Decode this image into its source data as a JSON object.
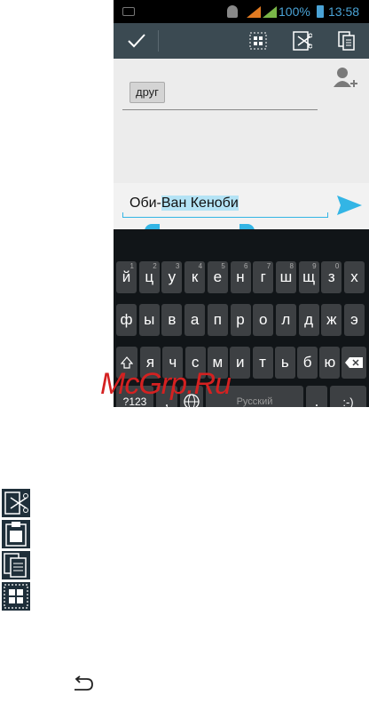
{
  "status_bar": {
    "battery": "100%",
    "time": "13:58"
  },
  "recipients": {
    "chip_label": "друг"
  },
  "message": {
    "text_before": "Оби-",
    "text_selected": "Ван Кеноби"
  },
  "keyboard": {
    "row1": [
      {
        "k": "й",
        "h": "1"
      },
      {
        "k": "ц",
        "h": "2"
      },
      {
        "k": "у",
        "h": "3"
      },
      {
        "k": "к",
        "h": "4"
      },
      {
        "k": "е",
        "h": "5"
      },
      {
        "k": "н",
        "h": "6"
      },
      {
        "k": "г",
        "h": "7"
      },
      {
        "k": "ш",
        "h": "8"
      },
      {
        "k": "щ",
        "h": "9"
      },
      {
        "k": "з",
        "h": "0"
      },
      {
        "k": "х",
        "h": ""
      }
    ],
    "row2": [
      "ф",
      "ы",
      "в",
      "а",
      "п",
      "р",
      "о",
      "л",
      "д",
      "ж",
      "э"
    ],
    "row3": [
      "я",
      "ч",
      "с",
      "м",
      "и",
      "т",
      "ь",
      "б",
      "ю"
    ],
    "mode_key": "?123",
    "comma": ",",
    "space_label": "Русский",
    "period": ".",
    "smiley": ":-)"
  },
  "watermark": "McGrp.Ru",
  "colors": {
    "action_bar": "#3b4a52",
    "accent": "#33b5e5",
    "selection": "#b4e3f5",
    "keyboard_bg": "#111518",
    "key_bg": "#3d4043",
    "watermark": "#d42121"
  },
  "icons": {
    "action_done": "checkmark-icon",
    "action_select_all": "select-all-icon",
    "action_cut": "cut-icon",
    "action_copy": "copy-icon",
    "add_recipient": "add-contact-icon",
    "send": "send-icon",
    "legend": [
      "cut-icon",
      "paste-icon",
      "copy-icon",
      "select-all-icon"
    ],
    "back": "back-icon"
  }
}
